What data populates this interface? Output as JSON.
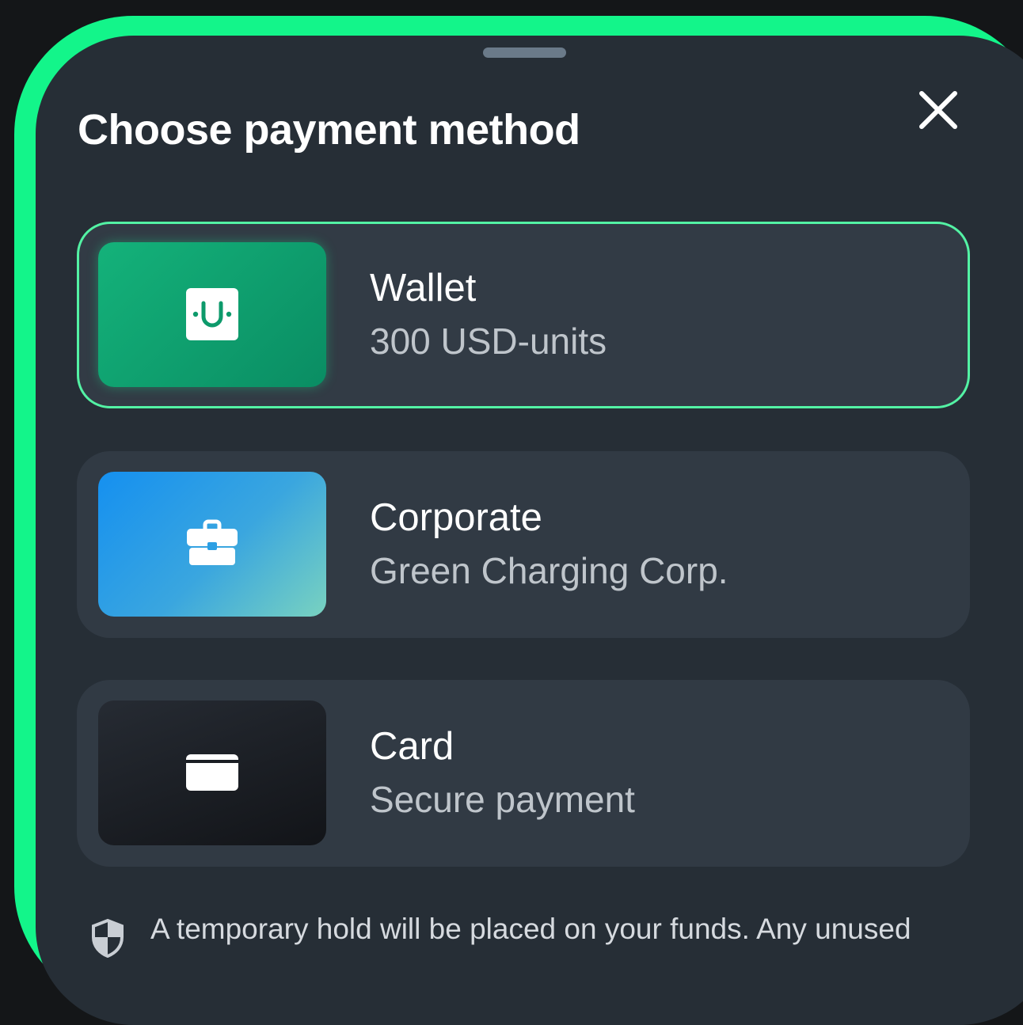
{
  "sheet": {
    "title": "Choose payment method",
    "close_icon": "close-icon",
    "accent_color": "#13f58a"
  },
  "options": [
    {
      "label": "Wallet",
      "sublabel": "300 USD-units",
      "icon": "wallet-u-icon",
      "selected": true
    },
    {
      "label": "Corporate",
      "sublabel": "Green Charging Corp.",
      "icon": "briefcase-icon",
      "selected": false
    },
    {
      "label": "Card",
      "sublabel": "Secure payment",
      "icon": "credit-card-icon",
      "selected": false
    }
  ],
  "notice": {
    "icon": "shield-icon",
    "text": "A temporary hold will be placed on your funds. Any unused"
  }
}
